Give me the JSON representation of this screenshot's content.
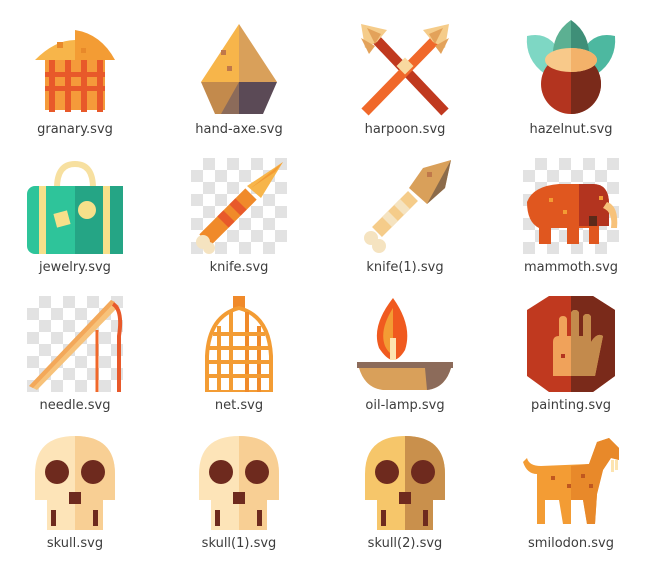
{
  "files": [
    {
      "name": "granary.svg",
      "icon": "granary-icon"
    },
    {
      "name": "hand-axe.svg",
      "icon": "hand-axe-icon"
    },
    {
      "name": "harpoon.svg",
      "icon": "harpoon-icon"
    },
    {
      "name": "hazelnut.svg",
      "icon": "hazelnut-icon"
    },
    {
      "name": "jewelry.svg",
      "icon": "jewelry-icon"
    },
    {
      "name": "knife.svg",
      "icon": "knife-icon"
    },
    {
      "name": "knife(1).svg",
      "icon": "knife-1-icon"
    },
    {
      "name": "mammoth.svg",
      "icon": "mammoth-icon"
    },
    {
      "name": "needle.svg",
      "icon": "needle-icon"
    },
    {
      "name": "net.svg",
      "icon": "net-icon"
    },
    {
      "name": "oil-lamp.svg",
      "icon": "oil-lamp-icon"
    },
    {
      "name": "painting.svg",
      "icon": "painting-icon"
    },
    {
      "name": "skull.svg",
      "icon": "skull-icon"
    },
    {
      "name": "skull(1).svg",
      "icon": "skull-1-icon"
    },
    {
      "name": "skull(2).svg",
      "icon": "skull-2-icon"
    },
    {
      "name": "smilodon.svg",
      "icon": "smilodon-icon"
    }
  ],
  "colors": {
    "label_text": "#3c3c3c",
    "orange": "#f39c34",
    "dark_orange": "#e8592a",
    "brown": "#8b4a2b",
    "cream": "#fbdca8",
    "teal": "#2ec4a0"
  }
}
